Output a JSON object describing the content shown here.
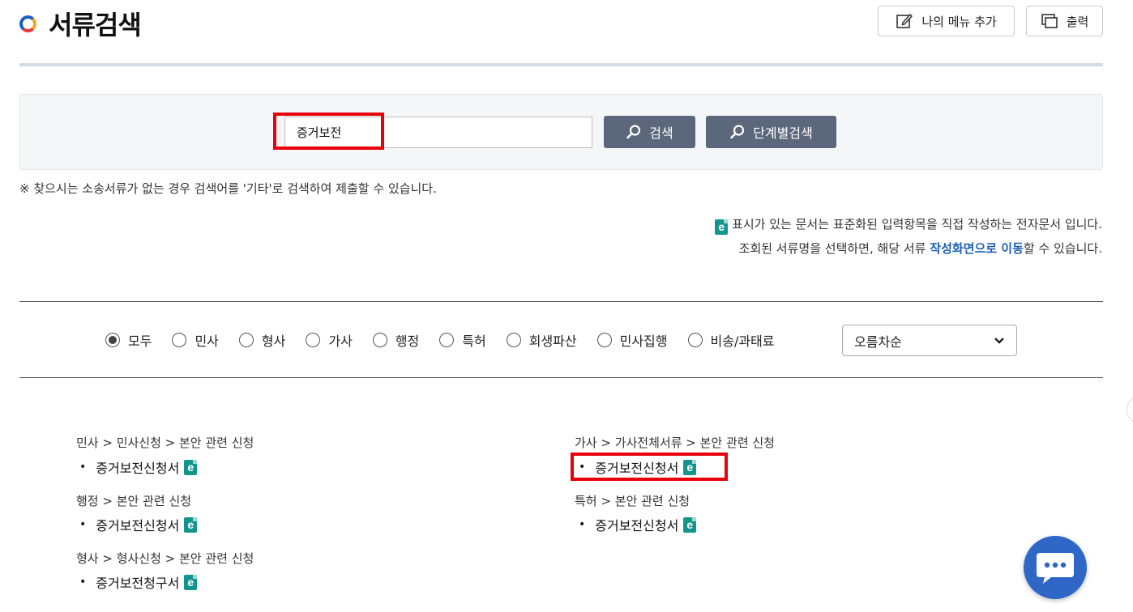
{
  "header": {
    "title": "서류검색",
    "my_menu_label": "나의 메뉴 추가",
    "print_label": "출력"
  },
  "search": {
    "value": "증거보전",
    "search_label": "검색",
    "step_search_label": "단계별검색"
  },
  "notice": "※ 찾으시는 소송서류가 없는 경우 검색어를 '기타'로 검색하여 제출할 수 있습니다.",
  "info": {
    "line1_text": "표시가 있는 문서는 표준화된 입력항목을 직접 작성하는 전자문서 입니다.",
    "line2_prefix": "조회된 서류명을 선택하면, 해당 서류 ",
    "line2_link": "작성화면으로 이동",
    "line2_suffix": "할 수 있습니다."
  },
  "filters": {
    "options": [
      "모두",
      "민사",
      "형사",
      "가사",
      "행정",
      "특허",
      "회생파산",
      "민사집행",
      "비송/과태료"
    ],
    "selected": "모두",
    "sort_value": "오름차순"
  },
  "results": [
    {
      "crumb": "민사 > 민사신청 > 본안 관련 신청",
      "doc": "증거보전신청서"
    },
    {
      "crumb": "행정 > 본안 관련 신청",
      "doc": "증거보전신청서"
    },
    {
      "crumb": "형사 > 형사신청 > 본안 관련 신청",
      "doc": "증거보전청구서"
    },
    {
      "crumb": "가사 > 가사전체서류 > 본안 관련 신청",
      "doc": "증거보전신청서"
    },
    {
      "crumb": "특허 > 본안 관련 신청",
      "doc": "증거보전신청서"
    }
  ],
  "icons": {
    "e_doc": "e-document-icon",
    "chat": "chat-bubble-icon"
  },
  "colors": {
    "accent_button": "#5b677a",
    "highlight": "#e8000b",
    "link": "#1e5fb3",
    "edoc_icon": "#13958d",
    "chat_button": "#2f67c7"
  }
}
